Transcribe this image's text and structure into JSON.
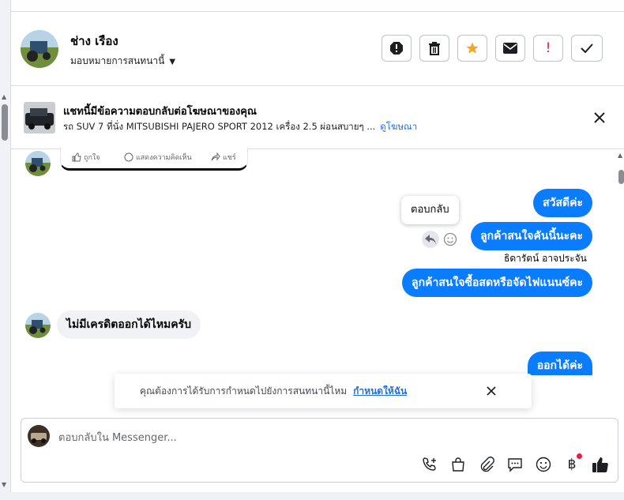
{
  "header": {
    "contact_name": "ช่าง เรือง",
    "assign_label": "มอบหมายการสนทนานี้"
  },
  "toolbar": {
    "actions": [
      "spam-alert-icon",
      "trash-icon",
      "star-icon",
      "envelope-icon",
      "exclamation-icon",
      "check-icon"
    ],
    "star_color": "#f5a623",
    "exclamation_color": "#e41e3f"
  },
  "ad_banner": {
    "title": "แชทนี้มีข้อความตอบกลับต่อโฆษณาของคุณ",
    "description": "รถ SUV 7 ที่นั่ง MITSUBISHI PAJERO SPORT 2012 เครื่อง 2.5 ผ่อนสบายๆ ...",
    "view_ad_label": "ดูโฆษณา"
  },
  "post_card": {
    "like_label": "ถูกใจ",
    "comment_label": "แสดงความคิดเห็น",
    "share_label": "แชร์"
  },
  "messages": [
    {
      "direction": "outgoing",
      "text": "สวัสดีค่ะ"
    },
    {
      "direction": "outgoing",
      "text": "ลูกค้าสนใจคันนี้นะคะ"
    },
    {
      "direction": "outgoing",
      "text": "ลูกค้าสนใจซื้อสดหรือจัดไฟแนนซ์คะ",
      "sender": "ธิดารัตน์ อาจประจัน"
    },
    {
      "direction": "incoming",
      "text": "ไม่มีเครดิตออกได้ไหมครับ"
    },
    {
      "direction": "outgoing",
      "text": "ออกได้ค่ะ"
    }
  ],
  "reply_tooltip": "ตอบกลับ",
  "toast": {
    "text": "คุณต้องการได้รับการกำหนดไปยังการสนทนานี้ไหม",
    "link": "กำหนดให้ฉัน"
  },
  "composer": {
    "placeholder": "ตอบกลับใน Messenger...",
    "tools": [
      "phone-plus-icon",
      "shopping-bag-icon",
      "paperclip-icon",
      "saved-reply-icon",
      "emoji-icon",
      "baht-icon",
      "like-icon"
    ]
  },
  "colors": {
    "accent": "#0a7cff",
    "link": "#216fdb",
    "notification_dot": "#e41e3f"
  }
}
